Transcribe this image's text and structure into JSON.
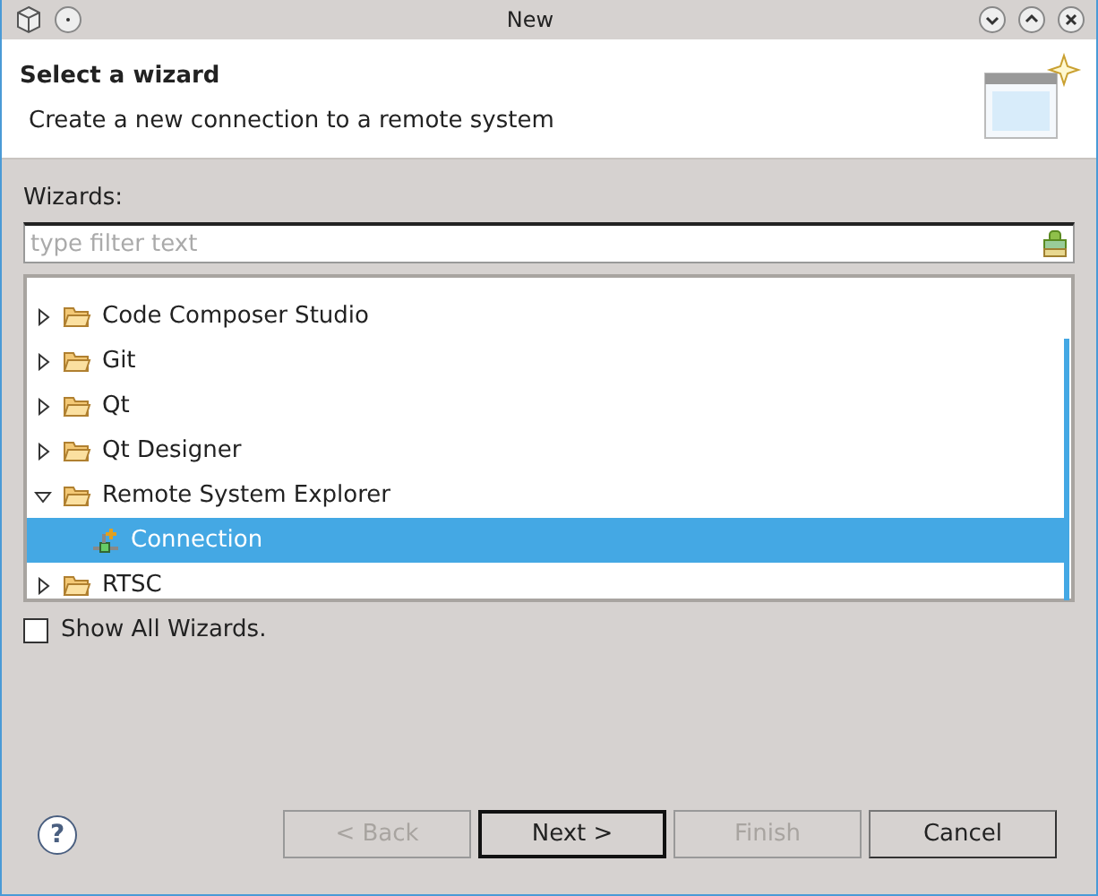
{
  "window": {
    "title": "New"
  },
  "header": {
    "title": "Select a wizard",
    "description": "Create a new connection to a remote system"
  },
  "wizards_label": "Wizards:",
  "filter": {
    "placeholder": "type filter text"
  },
  "tree": [
    {
      "label": "Code Composer Studio",
      "kind": "folder",
      "expanded": false,
      "selected": false
    },
    {
      "label": "Git",
      "kind": "folder",
      "expanded": false,
      "selected": false
    },
    {
      "label": "Qt",
      "kind": "folder",
      "expanded": false,
      "selected": false
    },
    {
      "label": "Qt Designer",
      "kind": "folder",
      "expanded": false,
      "selected": false
    },
    {
      "label": "Remote System Explorer",
      "kind": "folder",
      "expanded": true,
      "selected": false,
      "children": [
        {
          "label": "Connection",
          "kind": "wizard",
          "selected": true
        }
      ]
    },
    {
      "label": "RTSC",
      "kind": "folder",
      "expanded": false,
      "selected": false
    }
  ],
  "show_all": {
    "label": "Show All Wizards.",
    "checked": false
  },
  "help": {
    "label": "?"
  },
  "buttons": [
    {
      "label": "< Back",
      "disabled": true,
      "default": false
    },
    {
      "label": "Next >",
      "disabled": false,
      "default": true
    },
    {
      "label": "Finish",
      "disabled": true,
      "default": false
    },
    {
      "label": "Cancel",
      "disabled": false,
      "default": false
    }
  ]
}
